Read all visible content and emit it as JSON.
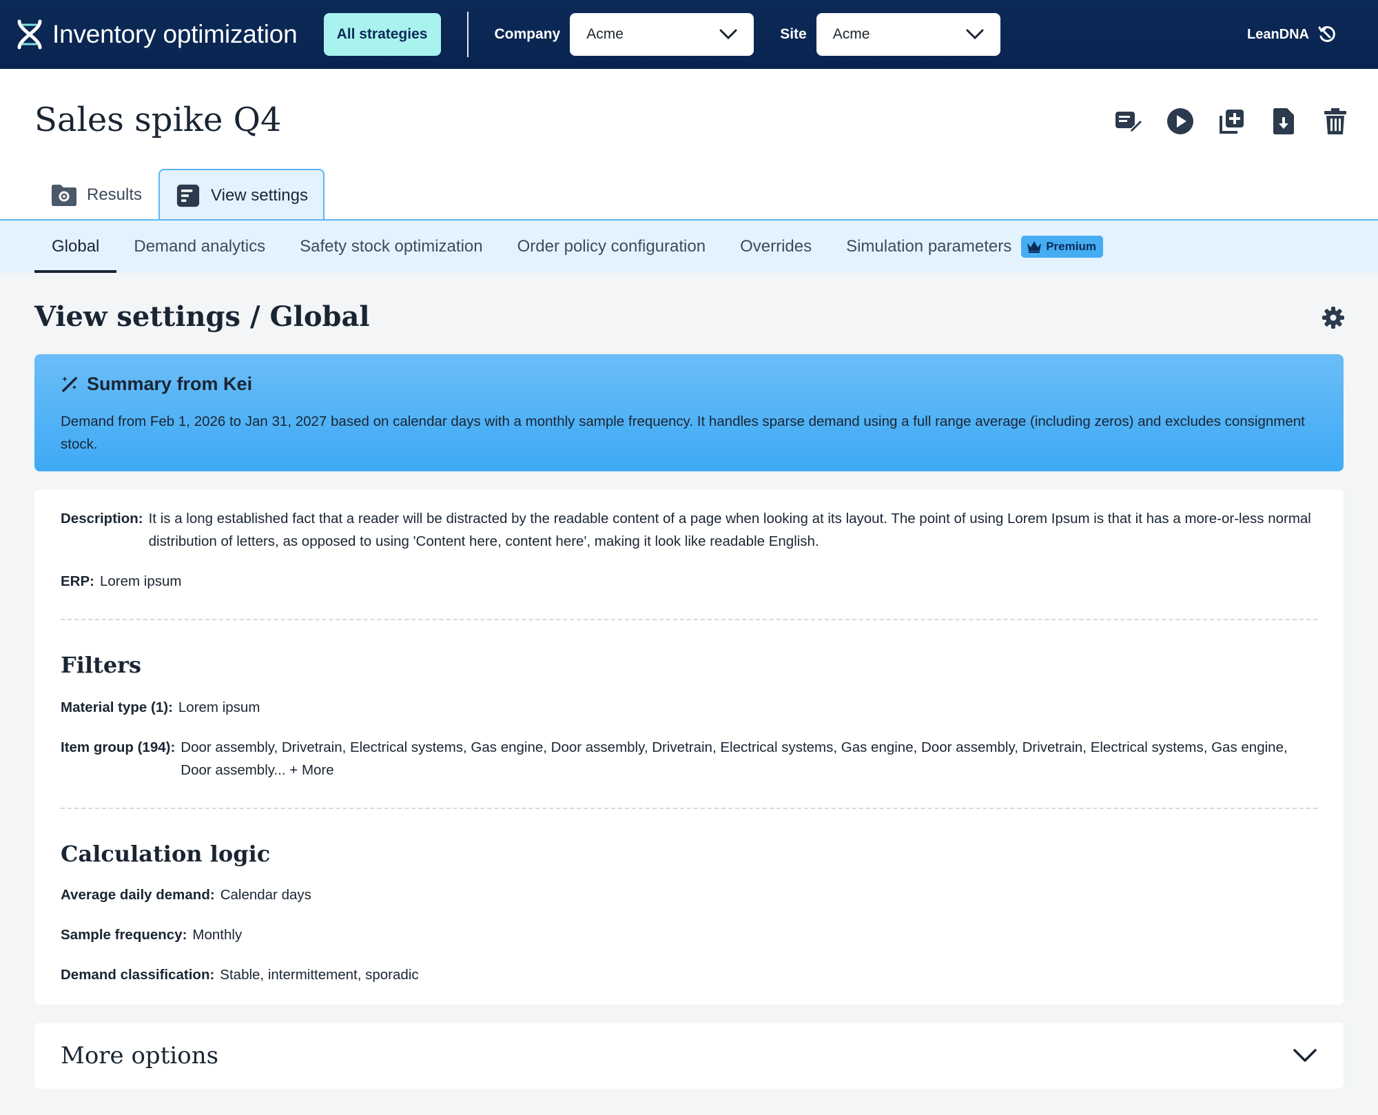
{
  "topbar": {
    "app_title": "Inventory optimization",
    "all_strategies_label": "All strategies",
    "company_label": "Company",
    "company_value": "Acme",
    "site_label": "Site",
    "site_value": "Acme",
    "account_label": "LeanDNA"
  },
  "header": {
    "title": "Sales spike Q4",
    "tabs": [
      {
        "label": "Results",
        "icon": "folder-gear-icon"
      },
      {
        "label": "View settings",
        "icon": "document-lines-icon",
        "active": true
      }
    ],
    "actions": [
      "edit-icon",
      "play-icon",
      "duplicate-icon",
      "download-icon",
      "trash-icon"
    ]
  },
  "subnav": {
    "items": [
      {
        "label": "Global",
        "active": true
      },
      {
        "label": "Demand analytics"
      },
      {
        "label": "Safety stock optimization"
      },
      {
        "label": "Order policy configuration"
      },
      {
        "label": "Overrides"
      },
      {
        "label": "Simulation parameters"
      }
    ],
    "premium_label": "Premium"
  },
  "content": {
    "heading": "View settings / Global",
    "summary": {
      "title": "Summary from Kei",
      "text": "Demand from Feb 1, 2026 to Jan 31, 2027 based on calendar days with a monthly sample frequency. It handles sparse demand using a full range average (including zeros) and excludes consignment stock."
    },
    "details": {
      "description_label": "Description:",
      "description_value": "It is a long established fact that a reader will be distracted by the readable content of a page when looking at its layout. The point of using Lorem Ipsum is that it has a more-or-less normal distribution of letters, as opposed to using 'Content here, content here', making it look like readable English.",
      "erp_label": "ERP:",
      "erp_value": "Lorem ipsum"
    },
    "filters": {
      "heading": "Filters",
      "material_label": "Material type (1):",
      "material_value": "Lorem ipsum",
      "item_group_label": "Item group (194):",
      "item_group_value": "Door assembly, Drivetrain, Electrical systems, Gas engine, Door assembly, Drivetrain, Electrical systems, Gas engine, Door assembly, Drivetrain, Electrical systems, Gas engine, Door assembly...",
      "more_link": "+ More"
    },
    "calculation": {
      "heading": "Calculation logic",
      "avg_label": "Average daily demand:",
      "avg_value": "Calendar days",
      "freq_label": "Sample frequency:",
      "freq_value": "Monthly",
      "class_label": "Demand classification:",
      "class_value": "Stable, intermittement, sporadic"
    },
    "more_options": "More options"
  },
  "colors": {
    "topbar": "#0c2a57",
    "accent": "#a9f3ef",
    "summary_bg": "#45adf2",
    "subnav_bg": "#e4f2fd"
  }
}
